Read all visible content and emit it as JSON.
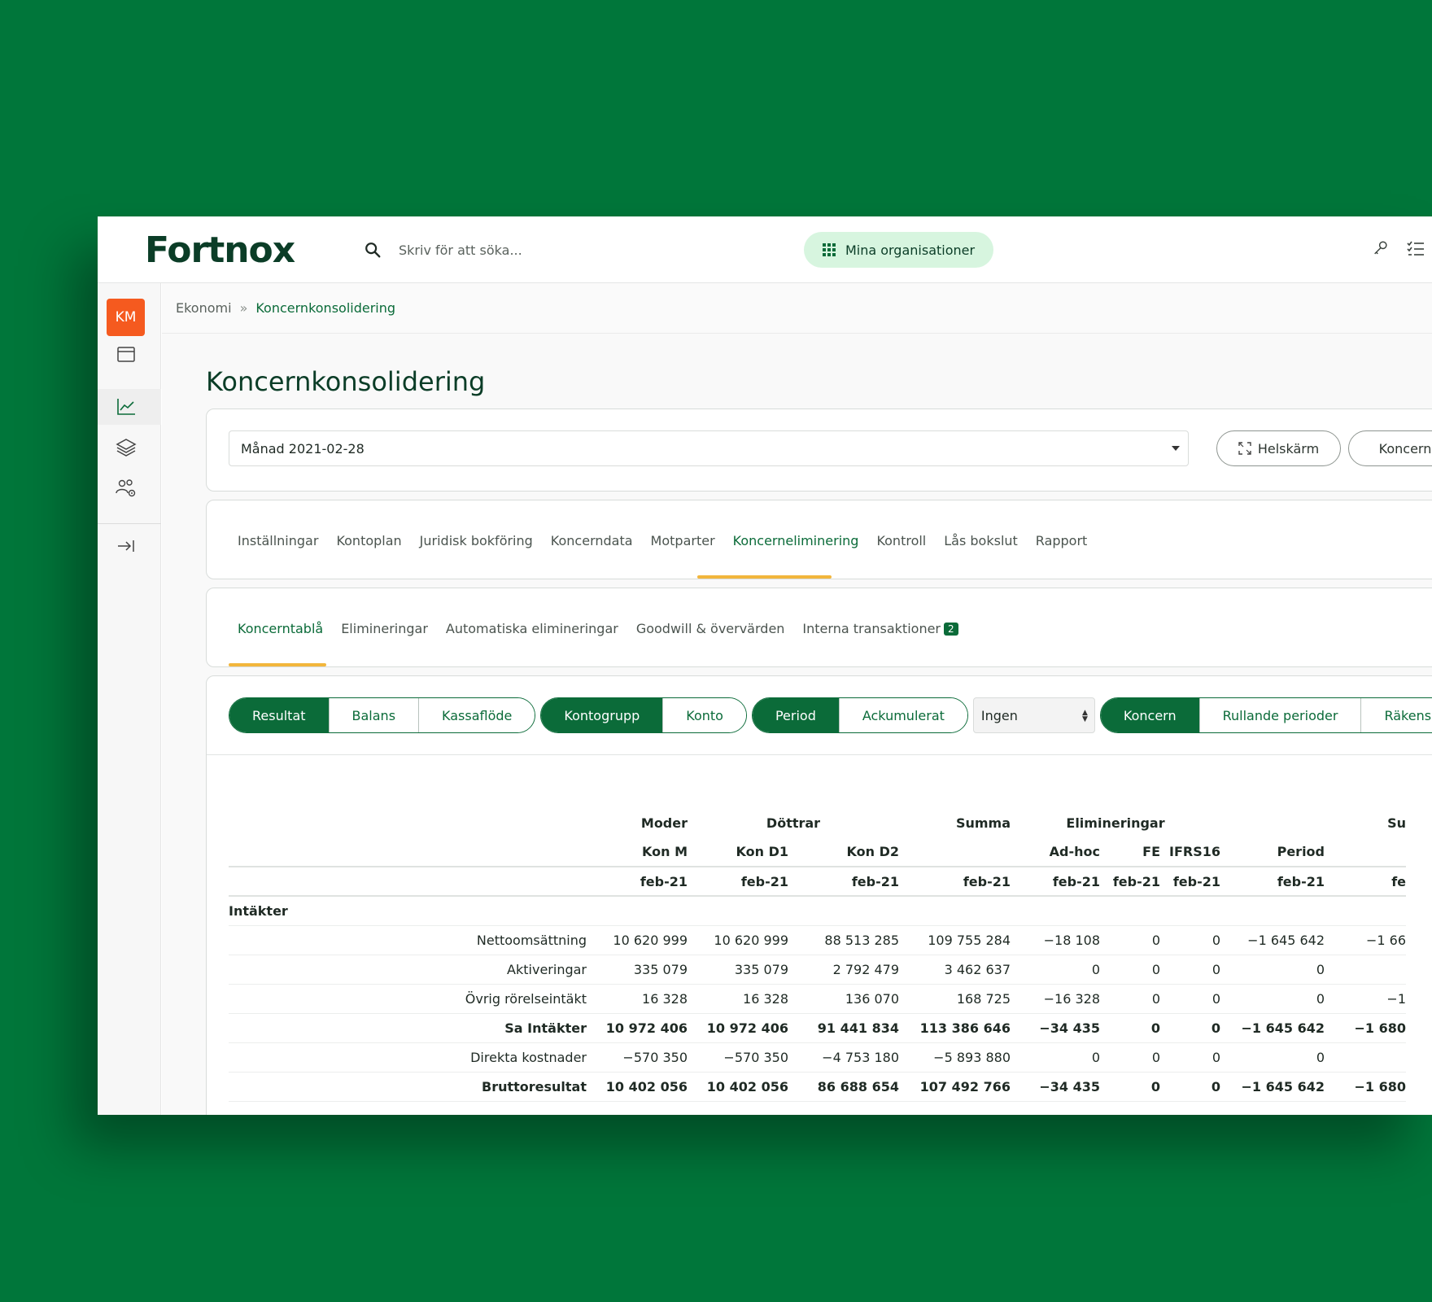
{
  "app": {
    "logo": "Fortnox",
    "search_placeholder": "Skriv för att söka...",
    "org_button": "Mina organisationer"
  },
  "sidebar": {
    "avatar": "KM",
    "icons": [
      "calendar-icon",
      "chart-icon",
      "layers-icon",
      "users-settings-icon",
      "collapse-arrow-icon"
    ]
  },
  "breadcrumb": {
    "parent": "Ekonomi",
    "separator": "»",
    "current": "Koncernkonsolidering"
  },
  "page": {
    "title": "Koncernkonsolidering"
  },
  "period_select": {
    "value": "Månad 2021-02-28"
  },
  "buttons": {
    "fullscreen": "Helskärm",
    "koncern": "Koncern"
  },
  "main_tabs": [
    {
      "label": "Inställningar"
    },
    {
      "label": "Kontoplan"
    },
    {
      "label": "Juridisk bokföring"
    },
    {
      "label": "Koncerndata"
    },
    {
      "label": "Motparter"
    },
    {
      "label": "Koncerneliminering"
    },
    {
      "label": "Kontroll"
    },
    {
      "label": "Lås bokslut"
    },
    {
      "label": "Rapport"
    }
  ],
  "main_tabs_active": "Koncerneliminering",
  "sub_tabs": [
    {
      "label": "Koncerntablå"
    },
    {
      "label": "Elimineringar"
    },
    {
      "label": "Automatiska elimineringar"
    },
    {
      "label": "Goodwill & övervärden"
    },
    {
      "label": "Interna transaktioner",
      "badge": "2"
    }
  ],
  "sub_tabs_active": "Koncerntablå",
  "toggles": {
    "report_type": [
      "Resultat",
      "Balans",
      "Kassaflöde"
    ],
    "level": [
      "Kontogrupp",
      "Konto"
    ],
    "period_mode": [
      "Period",
      "Ackumulerat"
    ],
    "compare_select": "Ingen",
    "scope": [
      "Koncern",
      "Rullande perioder",
      "Räkenskapsår"
    ]
  },
  "table": {
    "group_headers": {
      "moder": "Moder",
      "dottrar": "Döttrar",
      "summa": "Summa",
      "elimineringar": "Elimineringar",
      "last": "Su"
    },
    "sub_headers": [
      "Kon M",
      "Kon D1",
      "Kon D2",
      "",
      "Ad-hoc",
      "FE",
      "IFRS16",
      "Period",
      ""
    ],
    "period_row": [
      "feb-21",
      "feb-21",
      "feb-21",
      "feb-21",
      "feb-21",
      "feb-21",
      "feb-21",
      "feb-21",
      "fe"
    ],
    "section": "Intäkter",
    "rows": [
      {
        "label": "Nettoomsättning",
        "values": [
          "10 620 999",
          "10 620 999",
          "88 513 285",
          "109 755 284",
          "−18 108",
          "0",
          "0",
          "−1 645 642",
          "−1 66"
        ],
        "total": false
      },
      {
        "label": "Aktiveringar",
        "values": [
          "335 079",
          "335 079",
          "2 792 479",
          "3 462 637",
          "0",
          "0",
          "0",
          "0",
          ""
        ],
        "total": false
      },
      {
        "label": "Övrig rörelseintäkt",
        "values": [
          "16 328",
          "16 328",
          "136 070",
          "168 725",
          "−16 328",
          "0",
          "0",
          "0",
          "−1"
        ],
        "total": false
      },
      {
        "label": "Sa Intäkter",
        "values": [
          "10 972 406",
          "10 972 406",
          "91 441 834",
          "113 386 646",
          "−34 435",
          "0",
          "0",
          "−1 645 642",
          "−1 680"
        ],
        "total": true
      },
      {
        "label": "Direkta kostnader",
        "values": [
          "−570 350",
          "−570 350",
          "−4 753 180",
          "−5 893 880",
          "0",
          "0",
          "0",
          "0",
          ""
        ],
        "total": false
      },
      {
        "label": "Bruttoresultat",
        "values": [
          "10 402 056",
          "10 402 056",
          "86 688 654",
          "107 492 766",
          "−34 435",
          "0",
          "0",
          "−1 645 642",
          "−1 680"
        ],
        "total": true
      }
    ]
  },
  "colors": {
    "background": "#00763a",
    "brand_dark": "#0b3d27",
    "brand_green": "#0b6b39",
    "avatar": "#f55a1f",
    "tab_underline": "#f2b63c"
  }
}
